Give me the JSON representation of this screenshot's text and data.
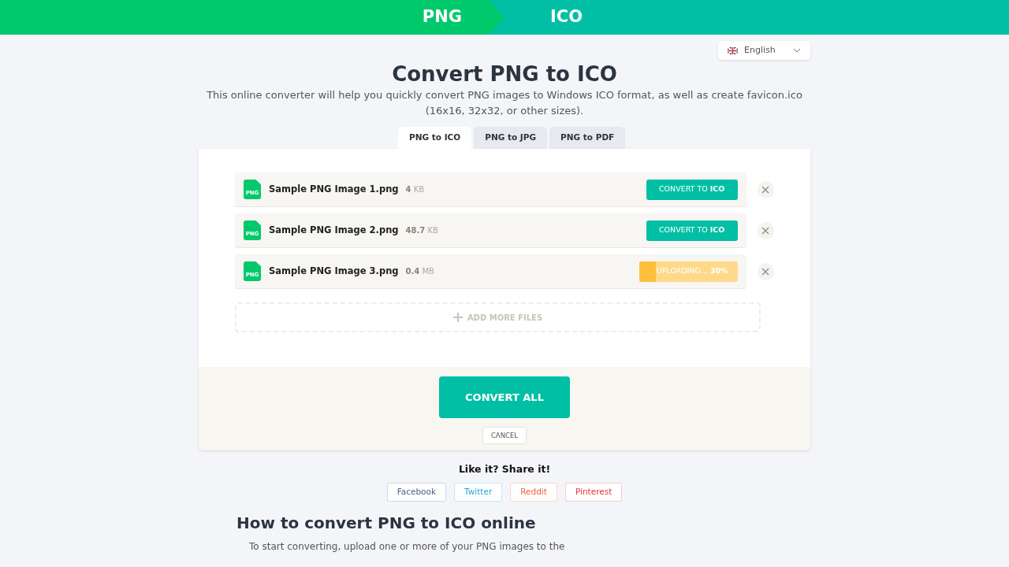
{
  "header": {
    "from": "PNG",
    "to": "ICO"
  },
  "language": {
    "value": "English"
  },
  "title": "Convert PNG to ICO",
  "subtitle": "This online converter will help you quickly convert PNG images to Windows ICO format, as well as create favicon.ico (16x16, 32x32, or other sizes).",
  "tabs": [
    {
      "label": "PNG to ICO",
      "selected": true
    },
    {
      "label": "PNG to JPG",
      "selected": false
    },
    {
      "label": "PNG to PDF",
      "selected": false
    }
  ],
  "files": [
    {
      "icon_label": "PNG",
      "name": "Sample PNG Image 1.png",
      "size": "**4** KB",
      "kind": "ready",
      "action": "CONVERT TO **ICO**"
    },
    {
      "icon_label": "PNG",
      "name": "Sample PNG Image 2.png",
      "size": "**48.7** KB",
      "kind": "ready",
      "action": "CONVERT TO **ICO**"
    },
    {
      "icon_label": "PNG",
      "name": "Sample PNG Image 3.png",
      "size": "**0.4** MB",
      "kind": "uploading",
      "action": "UPLOADING... **30%**",
      "level": 0.17
    }
  ],
  "add_more": "ADD MORE FILES",
  "convert_all": "CONVERT ALL",
  "cancel": "CANCEL",
  "share": {
    "title": "Like it? Share it!",
    "buttons": [
      {
        "label": "Facebook",
        "color": "#4a5f8f"
      },
      {
        "label": "Twitter",
        "color": "#2aa3dc"
      },
      {
        "label": "Reddit",
        "color": "#f0603a"
      },
      {
        "label": "Pinterest",
        "color": "#e3363f"
      }
    ]
  },
  "howto": {
    "title": "How to convert PNG to ICO online",
    "text": "To start converting, upload one or more of your PNG images to the"
  }
}
